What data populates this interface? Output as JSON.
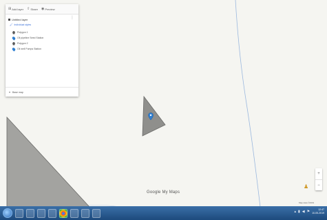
{
  "toolbar": {
    "add_layer": "Add layer",
    "share": "Share",
    "preview": "Preview"
  },
  "layer": {
    "title": "Untitled layer",
    "style": "Individual styles",
    "menu_icon": "more-vert-icon",
    "items": [
      {
        "label": "Polygon 1",
        "icon": "polygon-icon"
      },
      {
        "label": "Oil pipeline Seed Station",
        "icon": "pin-icon"
      },
      {
        "label": "Polygon 2",
        "icon": "polygon-icon"
      },
      {
        "label": "Oil well Pumps Station",
        "icon": "pin-icon"
      }
    ]
  },
  "basemap": {
    "label": "Base map"
  },
  "map": {
    "logo_part1": "Google",
    "logo_part2": "My Maps",
    "attribution": "Map data ©2019",
    "zoom_in": "+",
    "zoom_out": "−",
    "colors": {
      "polygon_fill": "#9a9a97",
      "polygon_stroke": "#6a6a68",
      "marker": "#2f7fd1",
      "river": "#9bb8de"
    }
  },
  "taskbar": {
    "time": "12:47",
    "date": "10-05-2019"
  }
}
